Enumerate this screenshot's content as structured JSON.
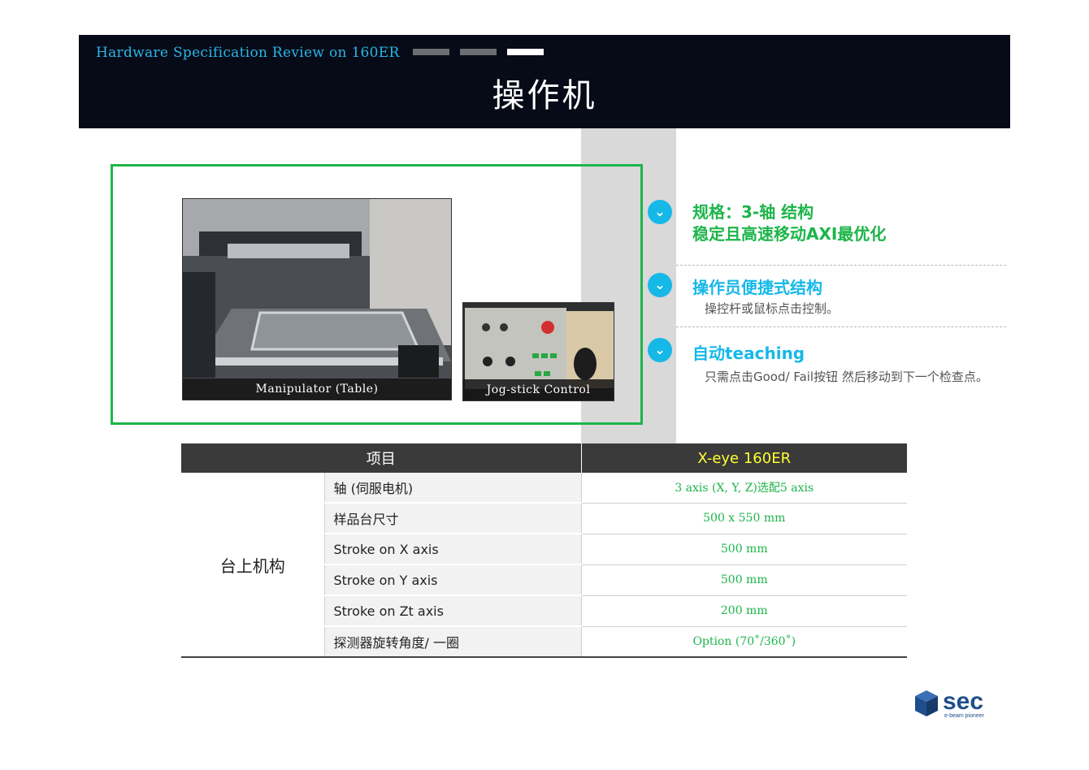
{
  "header": {
    "subtitle": "Hardware Specification Review on 160ER",
    "title": "操作机",
    "progress_bars": [
      "#6b6e73",
      "#6b6e73",
      "#ffffff"
    ]
  },
  "photos": [
    {
      "caption": "Manipulator (Table)"
    },
    {
      "caption": "Jog-stick Control"
    }
  ],
  "features": [
    {
      "title_lines": [
        "规格：3-轴 结构",
        "稳定且高速移动AXI最优化"
      ],
      "color": "#1db54a",
      "desc": ""
    },
    {
      "title_lines": [
        "操作员便捷式结构"
      ],
      "color": "#16b8e8",
      "desc": "操控杆或鼠标点击控制。"
    },
    {
      "title_lines": [
        "自动teaching"
      ],
      "color": "#16b8e8",
      "desc": "只需点击Good/ Fail按钮 然后移动到下一个检查点。"
    }
  ],
  "table": {
    "headers": [
      "项目",
      "X-eye 160ER"
    ],
    "header_accent": "#ffff33",
    "group": "台上机构",
    "rows": [
      {
        "item": "轴 (伺服电机)",
        "value": "3 axis (X, Y, Z)选配5 axis"
      },
      {
        "item": "样品台尺寸",
        "value": "500 x 550 mm"
      },
      {
        "item": "Stroke on X axis",
        "value": "500 mm"
      },
      {
        "item": "Stroke on Y axis",
        "value": "500 mm"
      },
      {
        "item": "Stroke on Zt axis",
        "value": "200 mm"
      },
      {
        "item": "探测器旋转角度/ 一圈",
        "value": "Option (70˚/360˚)"
      }
    ]
  },
  "logo": {
    "name": "sec",
    "tagline": "e-beam pioneer",
    "color": "#1f4e8c"
  }
}
